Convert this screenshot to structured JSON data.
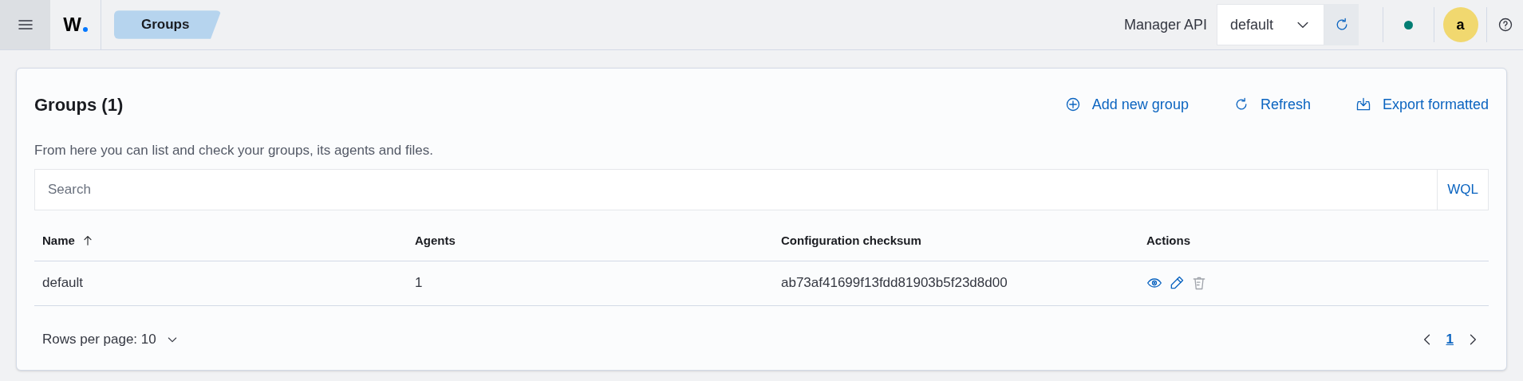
{
  "header": {
    "logo": "W",
    "breadcrumb": "Groups",
    "api_label": "Manager API",
    "api_select": "default",
    "avatar": "a"
  },
  "panel": {
    "title": "Groups (1)",
    "toolbar": [
      {
        "kind": "add",
        "label": "Add new group"
      },
      {
        "kind": "refresh",
        "label": "Refresh"
      },
      {
        "kind": "export",
        "label": "Export formatted"
      }
    ],
    "description": "From here you can list and check your groups, its agents and files.",
    "search": {
      "placeholder": "Search",
      "language": "WQL"
    },
    "table": {
      "columns": [
        {
          "label": "Name",
          "sorted": true
        },
        {
          "label": "Agents",
          "sorted": false
        },
        {
          "label": "Configuration checksum",
          "sorted": false
        },
        {
          "label": "Actions",
          "sorted": false
        }
      ],
      "rows": [
        {
          "cells": [
            "default",
            "1",
            "ab73af41699f13fdd81903b5f23d8d00"
          ],
          "actions": [
            {
              "kind": "view",
              "disabled": false
            },
            {
              "kind": "edit",
              "disabled": false
            },
            {
              "kind": "delete",
              "disabled": true
            }
          ]
        }
      ]
    },
    "pagination": {
      "rows_per_page": "Rows per page: 10",
      "pages": [
        {
          "label": "1",
          "selected": true
        }
      ]
    }
  }
}
